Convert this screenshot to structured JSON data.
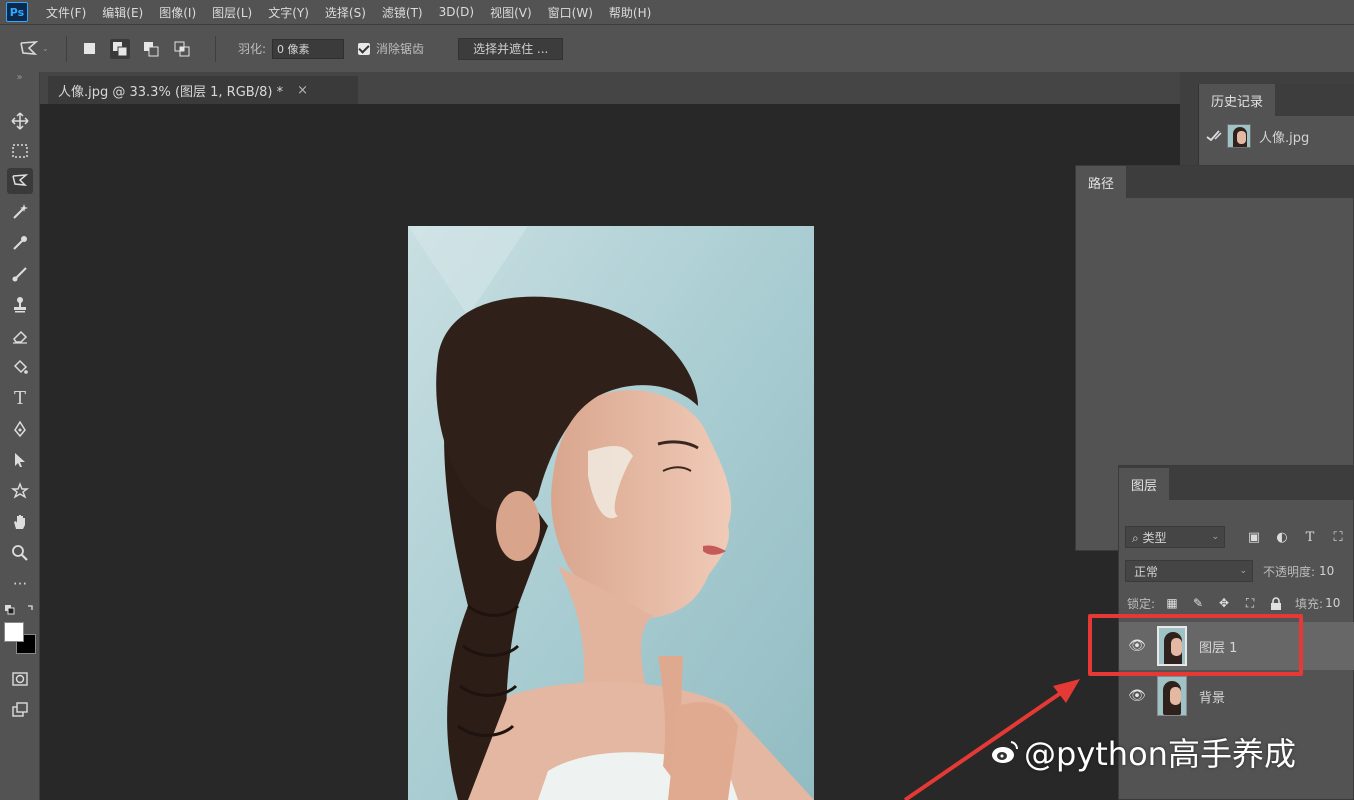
{
  "app": {
    "logo": "Ps",
    "menu": [
      "文件(F)",
      "编辑(E)",
      "图像(I)",
      "图层(L)",
      "文字(Y)",
      "选择(S)",
      "滤镜(T)",
      "3D(D)",
      "视图(V)",
      "窗口(W)",
      "帮助(H)"
    ]
  },
  "options_bar": {
    "tool_icon": "polygonal-lasso-icon",
    "feather_label": "羽化:",
    "feather_value": "0 像素",
    "antialias_label": "消除锯齿",
    "antialias_checked": true,
    "select_mask_label": "选择并遮住 ..."
  },
  "document": {
    "tab_title": "人像.jpg @ 33.3% (图层 1, RGB/8) *",
    "close_glyph": "×"
  },
  "history_panel": {
    "tab_label": "历史记录",
    "items": [
      {
        "label": "人像.jpg"
      }
    ]
  },
  "paths_panel": {
    "tab_label": "路径"
  },
  "layers_panel": {
    "tab_label": "图层",
    "filter_label": "⌕ 类型",
    "blend_mode": "正常",
    "opacity_label": "不透明度:",
    "opacity_value": "10",
    "lock_label": "锁定:",
    "fill_label": "填充:",
    "fill_value": "10",
    "layers": [
      {
        "name": "图层 1",
        "selected": true,
        "visible": true
      },
      {
        "name": "背景",
        "selected": false,
        "visible": true
      }
    ]
  },
  "annotation": {
    "highlight_color": "#e53935",
    "target": "图层 1"
  },
  "watermark": {
    "text": "@python高手养成"
  },
  "colors": {
    "ui_panel": "#535353",
    "ui_dark": "#282828",
    "accent_blue": "#31a8ff",
    "highlight_red": "#e53935"
  }
}
